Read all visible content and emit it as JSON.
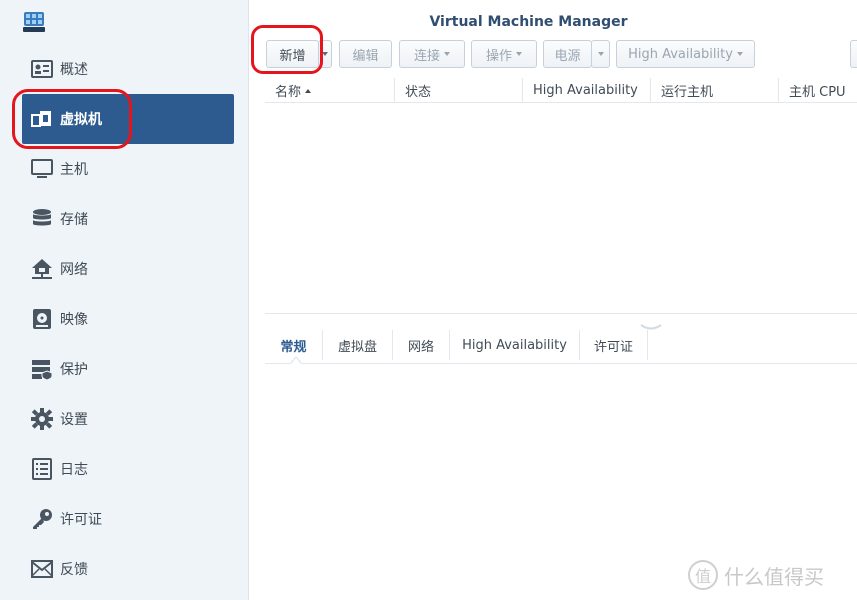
{
  "window": {
    "title": "Virtual Machine Manager"
  },
  "sidebar": {
    "items": [
      {
        "label": "概述",
        "icon": "overview-icon"
      },
      {
        "label": "虚拟机",
        "icon": "virtual-machine-icon",
        "active": true
      },
      {
        "label": "主机",
        "icon": "host-icon"
      },
      {
        "label": "存储",
        "icon": "storage-icon"
      },
      {
        "label": "网络",
        "icon": "network-icon"
      },
      {
        "label": "映像",
        "icon": "image-icon"
      },
      {
        "label": "保护",
        "icon": "protection-icon"
      },
      {
        "label": "设置",
        "icon": "gear-icon"
      },
      {
        "label": "日志",
        "icon": "log-icon"
      },
      {
        "label": "许可证",
        "icon": "key-icon"
      },
      {
        "label": "反馈",
        "icon": "mail-icon"
      }
    ]
  },
  "toolbar": {
    "add_label": "新增",
    "edit_label": "编辑",
    "connect_label": "连接",
    "action_label": "操作",
    "power_label": "电源",
    "ha_label": "High Availability"
  },
  "grid": {
    "columns": [
      "名称",
      "状态",
      "High Availability",
      "运行主机",
      "主机 CPU"
    ],
    "sorted_column": "名称",
    "sort_direction": "asc",
    "rows": []
  },
  "detail_tabs": {
    "tabs": [
      "常规",
      "虚拟盘",
      "网络",
      "High Availability",
      "许可证"
    ],
    "active": "常规"
  },
  "watermark": {
    "text": "什么值得买",
    "symbol": "值"
  },
  "colors": {
    "accent": "#2d5b8f",
    "annotation": "#e4151c",
    "title": "#2f4e70"
  }
}
